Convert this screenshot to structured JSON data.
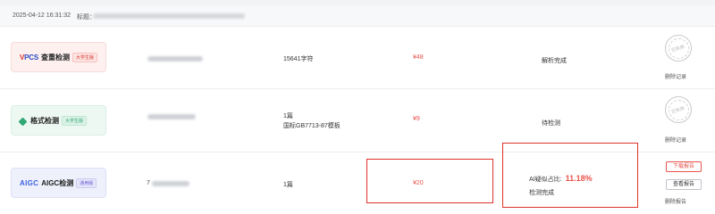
{
  "order": {
    "date": "2025-04-12 16:31:32",
    "title_label": "标题："
  },
  "items": [
    {
      "brand_v": "V",
      "brand_pcs": "PCS",
      "product_name": "查重检测",
      "tag": "大学生版",
      "count_line1": "15641字符",
      "count_line2": "",
      "price": "¥48",
      "status": "解析完成",
      "stamp_text": "已失效",
      "delete_label": "删除记录"
    },
    {
      "product_name": "格式检测",
      "tag": "大学生版",
      "count_line1": "1篇",
      "count_line2": "国标GB7713-87模板",
      "price": "¥9",
      "status": "待检测",
      "stamp_text": "已失效",
      "delete_label": "删除记录"
    },
    {
      "brand": "AIGC",
      "product_name": "AIGC检测",
      "tag": "通用版",
      "title_prefix": "7",
      "count_line1": "1篇",
      "count_line2": "",
      "price": "¥20",
      "ai_label": "AI疑似占比:",
      "ai_value": "11.18%",
      "status": "检测完成",
      "download_label": "下载报告",
      "view_label": "查看报告",
      "delete_label": "删除报告"
    }
  ],
  "colors": {
    "accent_red": "#e8524a",
    "highlight_red": "#e0302a",
    "green": "#2fa876",
    "blue": "#3c63e0"
  }
}
